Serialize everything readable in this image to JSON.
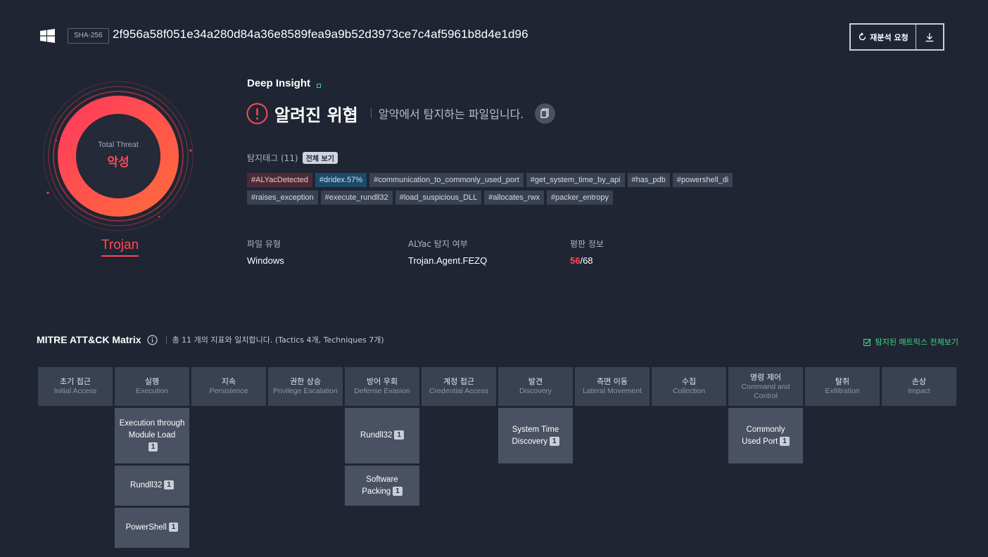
{
  "header": {
    "os_icon": "windows-icon",
    "hash_type": "SHA-256",
    "hash_value": "2f956a58f051e34a280d84a36e8589fea9a9b52d3973ce7c4af5961b8d4e1d96",
    "reanalyze_label": "재분석 요청",
    "download_icon": "download-icon"
  },
  "threat": {
    "total_label": "Total Threat",
    "verdict": "악성",
    "family": "Trojan",
    "ring_color": "#ff4a55"
  },
  "insight": {
    "title": "Deep Insight",
    "status": "알려진 위협",
    "description": "알약에서 탐지하는 파일입니다.",
    "alert_icon": "alert-circle-icon",
    "copy_icon": "copy-icon"
  },
  "tags": {
    "title": "탐지태그 (11)",
    "view_all": "전체 보기",
    "row1": [
      "#ALYacDetected",
      "#dridex.57%",
      "#communication_to_commonly_used_port",
      "#get_system_time_by_api",
      "#has_pdb",
      "#powershell_di"
    ],
    "row2": [
      "#raises_exception",
      "#execute_rundll32",
      "#load_suspicious_DLL",
      "#allocates_rwx",
      "#packer_entropy"
    ]
  },
  "info": {
    "file_type_label": "파일 유형",
    "file_type_value": "Windows",
    "alyac_label": "ALYac 탐지 여부",
    "alyac_value": "Trojan.Agent.FEZQ",
    "reputation_label": "평판 정보",
    "reputation_detected": "56",
    "reputation_total": "/68"
  },
  "mitre": {
    "title": "MITRE ATT&CK Matrix",
    "summary": "총 11 개의 지표와 일치합니다. (Tactics 4개, Techniques 7개)",
    "view_matrix": "탐지된 매트릭스 전체보기",
    "tactics": [
      {
        "ko": "초기 접근",
        "en": "Initial Access"
      },
      {
        "ko": "실행",
        "en": "Execution"
      },
      {
        "ko": "지속",
        "en": "Persistence"
      },
      {
        "ko": "권한 상승",
        "en": "Privilege Escalation"
      },
      {
        "ko": "방어 우회",
        "en": "Defense Evasion"
      },
      {
        "ko": "계정 접근",
        "en": "Credential Access"
      },
      {
        "ko": "발견",
        "en": "Discovery"
      },
      {
        "ko": "측면 이동",
        "en": "Lateral Movement"
      },
      {
        "ko": "수집",
        "en": "Collection"
      },
      {
        "ko": "명령 제어",
        "en": "Command and Control"
      },
      {
        "ko": "탈취",
        "en": "Exfiltration"
      },
      {
        "ko": "손상",
        "en": "Impact"
      }
    ],
    "techniques": {
      "execution": [
        {
          "name": "Execution through Module Load",
          "count": "1"
        },
        {
          "name": "Rundll32",
          "count": "1"
        },
        {
          "name": "PowerShell",
          "count": "1"
        }
      ],
      "defense_evasion": [
        {
          "name": "Rundll32",
          "count": "1"
        },
        {
          "name": "Software Packing",
          "count": "1"
        }
      ],
      "discovery": [
        {
          "name": "System Time Discovery",
          "count": "1"
        }
      ],
      "command_and_control": [
        {
          "name": "Commonly Used Port",
          "count": "1"
        }
      ]
    }
  }
}
